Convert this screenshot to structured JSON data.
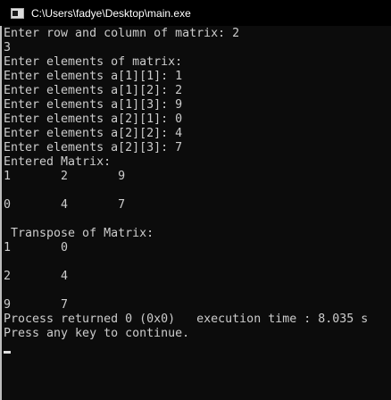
{
  "window": {
    "title": "C:\\Users\\fadye\\Desktop\\main.exe",
    "icon": "console-app-icon"
  },
  "console": {
    "lines": [
      "Enter row and column of matrix: 2",
      "3",
      "Enter elements of matrix:",
      "Enter elements a[1][1]: 1",
      "Enter elements a[1][2]: 2",
      "Enter elements a[1][3]: 9",
      "Enter elements a[2][1]: 0",
      "Enter elements a[2][2]: 4",
      "Enter elements a[2][3]: 7",
      "Entered Matrix:",
      "1       2       9",
      "",
      "0       4       7",
      "",
      " Transpose of Matrix:",
      "1       0",
      "",
      "2       4",
      "",
      "9       7",
      "Process returned 0 (0x0)   execution time : 8.035 s",
      "Press any key to continue."
    ]
  },
  "colors": {
    "background": "#0c0c0c",
    "text": "#cccccc",
    "titlebar": "#000000"
  }
}
